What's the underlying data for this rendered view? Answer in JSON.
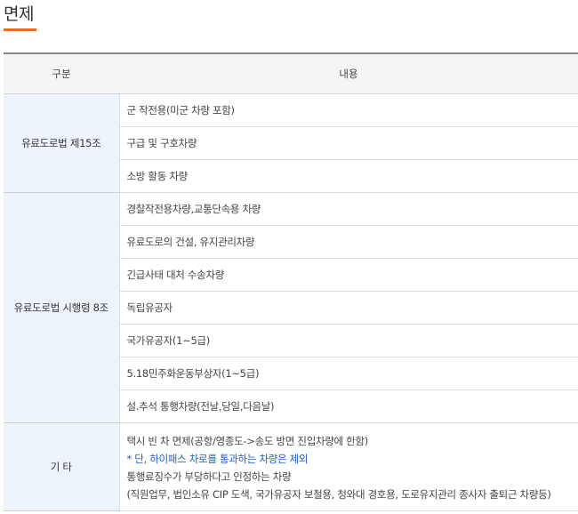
{
  "page": {
    "title": "면제",
    "accent_color": "#f06d1f"
  },
  "table": {
    "headers": [
      "구분",
      "내용"
    ],
    "group1": {
      "category": "유료도로법 제15조",
      "items": [
        "군 작전용(미군 차량 포함)",
        "구급 및 구호차량",
        "소방 활동 차량"
      ]
    },
    "group2": {
      "category": "유료도로법 시행령 8조",
      "items": [
        "경찰작전용차량,교통단속용 차량",
        "유료도로의 건설, 유지관리차량",
        "긴급사태 대처 수송차량",
        "독립유공자",
        "국가유공자(1~5급)",
        "5.18민주화운동부상자(1~5급)",
        "설.추석 통행차량(전날,당일,다음날)"
      ]
    },
    "group3": {
      "category": "기 타",
      "lines": [
        "택시 빈 차 면제(공항/영종도->송도 방면 진입차량에 한함)",
        "* 단, 하이패스 차로를 통과하는 차량은 제외",
        "통행료징수가 부당하다고 인정하는 차량",
        "(직원업무, 법인소유 CIP 도색, 국가유공자 보철용, 청와대 경호용, 도로유지관리 종사자 출퇴근 차량등)"
      ],
      "note_color": "#1f5fc2"
    }
  }
}
